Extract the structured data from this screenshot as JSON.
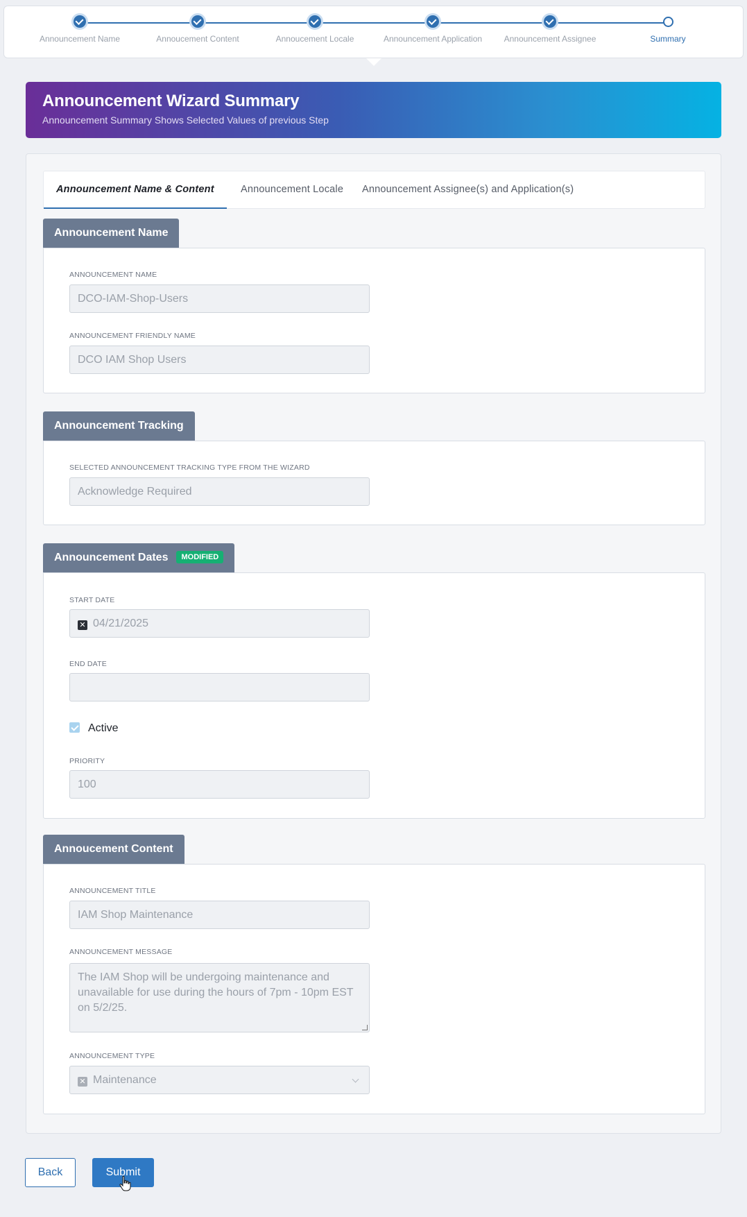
{
  "stepper": {
    "steps": [
      {
        "label": "Announcement Name",
        "status": "done"
      },
      {
        "label": "Annoucement Content",
        "status": "done"
      },
      {
        "label": "Annoucement Locale",
        "status": "done"
      },
      {
        "label": "Announcement Application",
        "status": "done"
      },
      {
        "label": "Announcement Assignee",
        "status": "done"
      },
      {
        "label": "Summary",
        "status": "current"
      }
    ]
  },
  "banner": {
    "title": "Announcement Wizard Summary",
    "subtitle": "Announcement Summary Shows Selected Values of previous Step"
  },
  "tabs": [
    {
      "label": "Announcement Name & Content",
      "active": true
    },
    {
      "label": "Announcement Locale",
      "active": false
    },
    {
      "label": "Announcement Assignee(s) and Application(s)",
      "active": false
    }
  ],
  "sections": {
    "name": {
      "title": "Announcement Name",
      "name_label": "ANNOUNCEMENT NAME",
      "name_value": "DCO-IAM-Shop-Users",
      "friendly_label": "ANNOUNCEMENT FRIENDLY NAME",
      "friendly_value": "DCO IAM Shop Users"
    },
    "tracking": {
      "title": "Announcement Tracking",
      "type_label": "SELECTED ANNOUNCEMENT TRACKING TYPE FROM THE WIZARD",
      "type_value": "Acknowledge Required"
    },
    "dates": {
      "title": "Announcement Dates",
      "badge": "MODIFIED",
      "start_label": "START DATE",
      "start_value": "04/21/2025",
      "end_label": "END DATE",
      "end_value": "",
      "active_label": "Active",
      "active_checked": true,
      "priority_label": "PRIORITY",
      "priority_value": "100"
    },
    "content": {
      "title": "Annoucement Content",
      "title_label": "ANNOUNCEMENT TITLE",
      "title_value": "IAM Shop Maintenance",
      "message_label": "ANNOUNCEMENT MESSAGE",
      "message_value": "The IAM Shop will be undergoing maintenance and unavailable for use during the hours of 7pm - 10pm EST on 5/2/25.",
      "type_label": "ANNOUNCEMENT TYPE",
      "type_value": "Maintenance"
    }
  },
  "buttons": {
    "back": "Back",
    "submit": "Submit"
  },
  "colors": {
    "accent": "#2f6fb0",
    "section_header": "#6b7a91",
    "badge": "#16b073",
    "gradient_start": "#6a2e98",
    "gradient_end": "#05b2e3"
  }
}
